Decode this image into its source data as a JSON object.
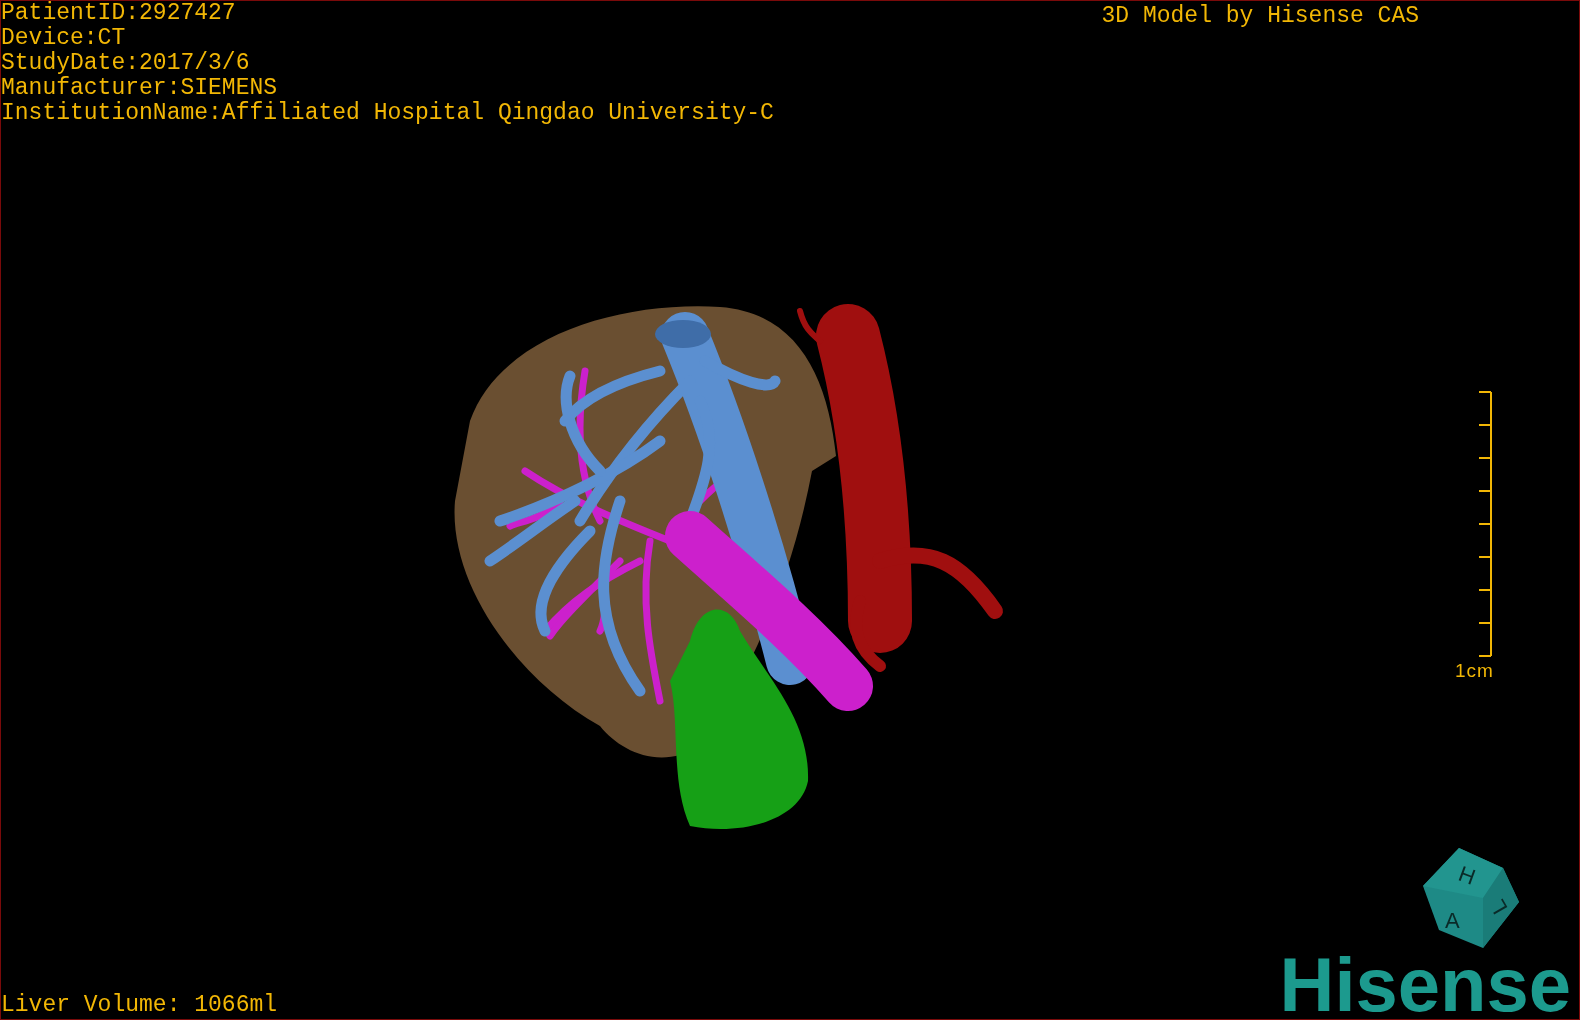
{
  "patient_info": [
    "PatientID:2927427",
    "Device:CT",
    "StudyDate:2017/3/6",
    "Manufacturer:SIEMENS",
    "InstitutionName:Affiliated Hospital Qingdao University-C"
  ],
  "title": "3D Model by Hisense CAS",
  "scale_bar": {
    "label": "1cm"
  },
  "liver_volume": "Liver Volume: 1066ml",
  "orientation_cube": {
    "labels": [
      "H",
      "A",
      "L"
    ]
  },
  "logo": "Hisense"
}
